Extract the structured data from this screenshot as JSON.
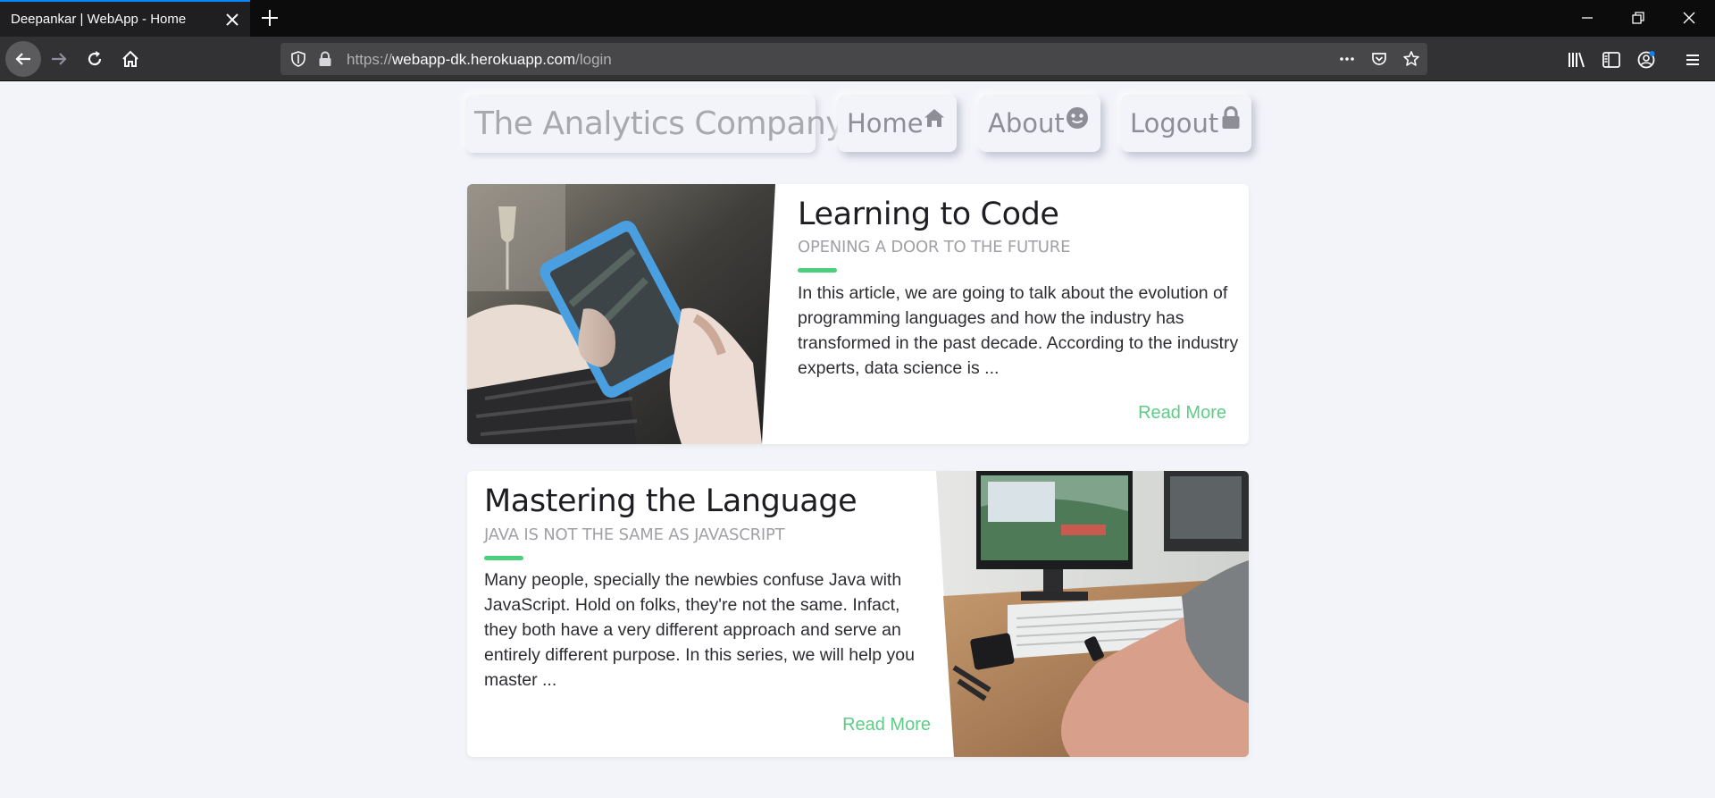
{
  "browser": {
    "tab_title": "Deepankar | WebApp - Home",
    "url_prefix": "https://",
    "url_host": "webapp-dk.herokuapp.com",
    "url_path": "/login",
    "accent_color": "#0a84ff"
  },
  "site": {
    "brand": "The Analytics Company",
    "nav": [
      {
        "label": "Home",
        "icon": "home-icon"
      },
      {
        "label": "About",
        "icon": "smile-face-icon"
      },
      {
        "label": "Logout",
        "icon": "lock-icon"
      }
    ]
  },
  "articles": [
    {
      "title": "Learning to Code",
      "subtitle": "OPENING A DOOR TO THE FUTURE",
      "excerpt": "In this article, we are going to talk about the evolution of programming languages and how the industry has transformed in the past decade. According to the industry experts, data science is ...",
      "link": "Read More",
      "image": "person-holding-tablet-photo",
      "image_side": "left"
    },
    {
      "title": "Mastering the Language",
      "subtitle": "JAVA IS NOT THE SAME AS JAVASCRIPT",
      "excerpt": "Many people, specially the newbies confuse Java with JavaScript. Hold on folks, they're not the same. Infact, they both have a very different approach and serve an entirely different purpose. In this series, we will help you master ...",
      "link": "Read More",
      "image": "desk-with-computer-photo",
      "image_side": "right"
    }
  ],
  "colors": {
    "accent_green": "#4ccf7a",
    "link_green": "#5dcd86",
    "page_bg": "#f3f4f9"
  }
}
